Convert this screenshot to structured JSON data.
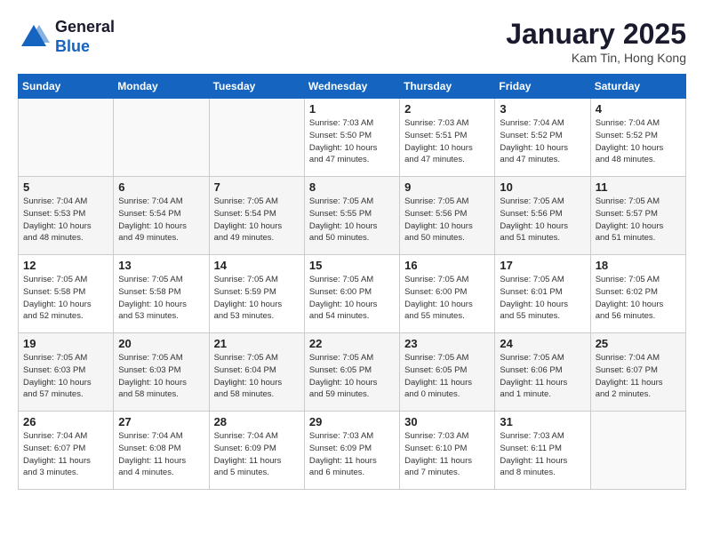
{
  "header": {
    "logo_line1": "General",
    "logo_line2": "Blue",
    "month": "January 2025",
    "location": "Kam Tin, Hong Kong"
  },
  "weekdays": [
    "Sunday",
    "Monday",
    "Tuesday",
    "Wednesday",
    "Thursday",
    "Friday",
    "Saturday"
  ],
  "weeks": [
    [
      {
        "day": "",
        "info": ""
      },
      {
        "day": "",
        "info": ""
      },
      {
        "day": "",
        "info": ""
      },
      {
        "day": "1",
        "info": "Sunrise: 7:03 AM\nSunset: 5:50 PM\nDaylight: 10 hours\nand 47 minutes."
      },
      {
        "day": "2",
        "info": "Sunrise: 7:03 AM\nSunset: 5:51 PM\nDaylight: 10 hours\nand 47 minutes."
      },
      {
        "day": "3",
        "info": "Sunrise: 7:04 AM\nSunset: 5:52 PM\nDaylight: 10 hours\nand 47 minutes."
      },
      {
        "day": "4",
        "info": "Sunrise: 7:04 AM\nSunset: 5:52 PM\nDaylight: 10 hours\nand 48 minutes."
      }
    ],
    [
      {
        "day": "5",
        "info": "Sunrise: 7:04 AM\nSunset: 5:53 PM\nDaylight: 10 hours\nand 48 minutes."
      },
      {
        "day": "6",
        "info": "Sunrise: 7:04 AM\nSunset: 5:54 PM\nDaylight: 10 hours\nand 49 minutes."
      },
      {
        "day": "7",
        "info": "Sunrise: 7:05 AM\nSunset: 5:54 PM\nDaylight: 10 hours\nand 49 minutes."
      },
      {
        "day": "8",
        "info": "Sunrise: 7:05 AM\nSunset: 5:55 PM\nDaylight: 10 hours\nand 50 minutes."
      },
      {
        "day": "9",
        "info": "Sunrise: 7:05 AM\nSunset: 5:56 PM\nDaylight: 10 hours\nand 50 minutes."
      },
      {
        "day": "10",
        "info": "Sunrise: 7:05 AM\nSunset: 5:56 PM\nDaylight: 10 hours\nand 51 minutes."
      },
      {
        "day": "11",
        "info": "Sunrise: 7:05 AM\nSunset: 5:57 PM\nDaylight: 10 hours\nand 51 minutes."
      }
    ],
    [
      {
        "day": "12",
        "info": "Sunrise: 7:05 AM\nSunset: 5:58 PM\nDaylight: 10 hours\nand 52 minutes."
      },
      {
        "day": "13",
        "info": "Sunrise: 7:05 AM\nSunset: 5:58 PM\nDaylight: 10 hours\nand 53 minutes."
      },
      {
        "day": "14",
        "info": "Sunrise: 7:05 AM\nSunset: 5:59 PM\nDaylight: 10 hours\nand 53 minutes."
      },
      {
        "day": "15",
        "info": "Sunrise: 7:05 AM\nSunset: 6:00 PM\nDaylight: 10 hours\nand 54 minutes."
      },
      {
        "day": "16",
        "info": "Sunrise: 7:05 AM\nSunset: 6:00 PM\nDaylight: 10 hours\nand 55 minutes."
      },
      {
        "day": "17",
        "info": "Sunrise: 7:05 AM\nSunset: 6:01 PM\nDaylight: 10 hours\nand 55 minutes."
      },
      {
        "day": "18",
        "info": "Sunrise: 7:05 AM\nSunset: 6:02 PM\nDaylight: 10 hours\nand 56 minutes."
      }
    ],
    [
      {
        "day": "19",
        "info": "Sunrise: 7:05 AM\nSunset: 6:03 PM\nDaylight: 10 hours\nand 57 minutes."
      },
      {
        "day": "20",
        "info": "Sunrise: 7:05 AM\nSunset: 6:03 PM\nDaylight: 10 hours\nand 58 minutes."
      },
      {
        "day": "21",
        "info": "Sunrise: 7:05 AM\nSunset: 6:04 PM\nDaylight: 10 hours\nand 58 minutes."
      },
      {
        "day": "22",
        "info": "Sunrise: 7:05 AM\nSunset: 6:05 PM\nDaylight: 10 hours\nand 59 minutes."
      },
      {
        "day": "23",
        "info": "Sunrise: 7:05 AM\nSunset: 6:05 PM\nDaylight: 11 hours\nand 0 minutes."
      },
      {
        "day": "24",
        "info": "Sunrise: 7:05 AM\nSunset: 6:06 PM\nDaylight: 11 hours\nand 1 minute."
      },
      {
        "day": "25",
        "info": "Sunrise: 7:04 AM\nSunset: 6:07 PM\nDaylight: 11 hours\nand 2 minutes."
      }
    ],
    [
      {
        "day": "26",
        "info": "Sunrise: 7:04 AM\nSunset: 6:07 PM\nDaylight: 11 hours\nand 3 minutes."
      },
      {
        "day": "27",
        "info": "Sunrise: 7:04 AM\nSunset: 6:08 PM\nDaylight: 11 hours\nand 4 minutes."
      },
      {
        "day": "28",
        "info": "Sunrise: 7:04 AM\nSunset: 6:09 PM\nDaylight: 11 hours\nand 5 minutes."
      },
      {
        "day": "29",
        "info": "Sunrise: 7:03 AM\nSunset: 6:09 PM\nDaylight: 11 hours\nand 6 minutes."
      },
      {
        "day": "30",
        "info": "Sunrise: 7:03 AM\nSunset: 6:10 PM\nDaylight: 11 hours\nand 7 minutes."
      },
      {
        "day": "31",
        "info": "Sunrise: 7:03 AM\nSunset: 6:11 PM\nDaylight: 11 hours\nand 8 minutes."
      },
      {
        "day": "",
        "info": ""
      }
    ]
  ]
}
